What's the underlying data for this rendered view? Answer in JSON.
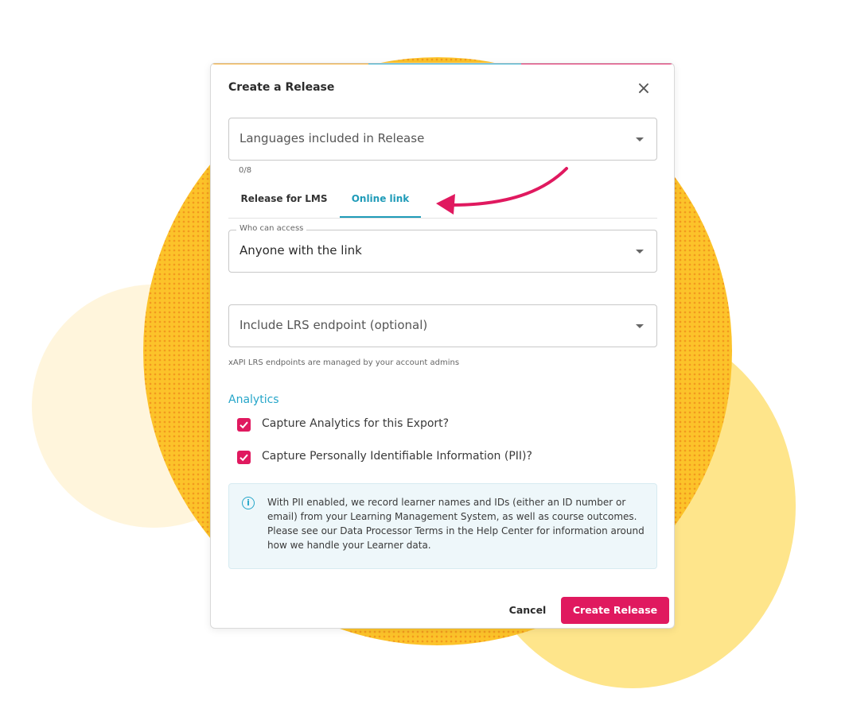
{
  "modal": {
    "title": "Create a Release",
    "close_label": "×"
  },
  "languages": {
    "placeholder": "Languages included in Release",
    "counter": "0/8"
  },
  "tabs": [
    {
      "label": "Release for LMS",
      "active": false
    },
    {
      "label": "Online link",
      "active": true
    }
  ],
  "access": {
    "legend": "Who can access",
    "value": "Anyone with the link"
  },
  "lrs": {
    "placeholder": "Include LRS endpoint (optional)",
    "helper": "xAPI LRS endpoints are managed by your account admins"
  },
  "analytics": {
    "title": "Analytics",
    "options": [
      {
        "label": "Capture Analytics for this Export?",
        "checked": true
      },
      {
        "label": "Capture Personally Identifiable Information (PII)?",
        "checked": true
      }
    ]
  },
  "info": {
    "icon": "info-icon",
    "text": "With PII enabled, we record learner names and IDs (either an ID number or email) from your Learning Management System, as well as course outcomes. Please see our Data Processor Terms in the Help Center for information around how we handle your Learner data."
  },
  "footer": {
    "cancel_label": "Cancel",
    "create_label": "Create Release"
  },
  "colors": {
    "accent_pink": "#e0195f",
    "accent_teal": "#26a6c9",
    "background_orange": "#fcc32a",
    "background_yellow": "#fee58b"
  }
}
